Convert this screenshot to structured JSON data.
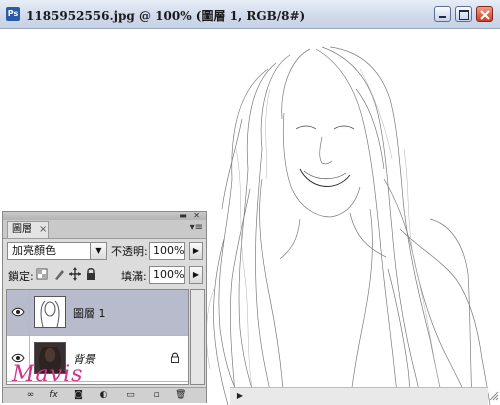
{
  "window": {
    "app_badge": "Ps",
    "title": "1185952556.jpg @ 100% (圖層 1, RGB/8#)"
  },
  "layers_panel": {
    "tab_label": "圖層",
    "blend_mode": "加亮顏色",
    "opacity_label": "不透明:",
    "opacity_value": "100%",
    "lock_label": "鎖定:",
    "fill_label": "填滿:",
    "fill_value": "100%",
    "layers": [
      {
        "name": "圖層 1",
        "visible": true,
        "selected": true
      },
      {
        "name": "背景",
        "visible": true,
        "selected": false,
        "locked": true
      }
    ],
    "bottom_icons": [
      "link-layers-icon",
      "fx-icon",
      "add-mask-icon",
      "adjustment-layer-icon",
      "new-group-icon",
      "new-layer-icon",
      "delete-layer-icon"
    ]
  },
  "watermark": "Mavis"
}
